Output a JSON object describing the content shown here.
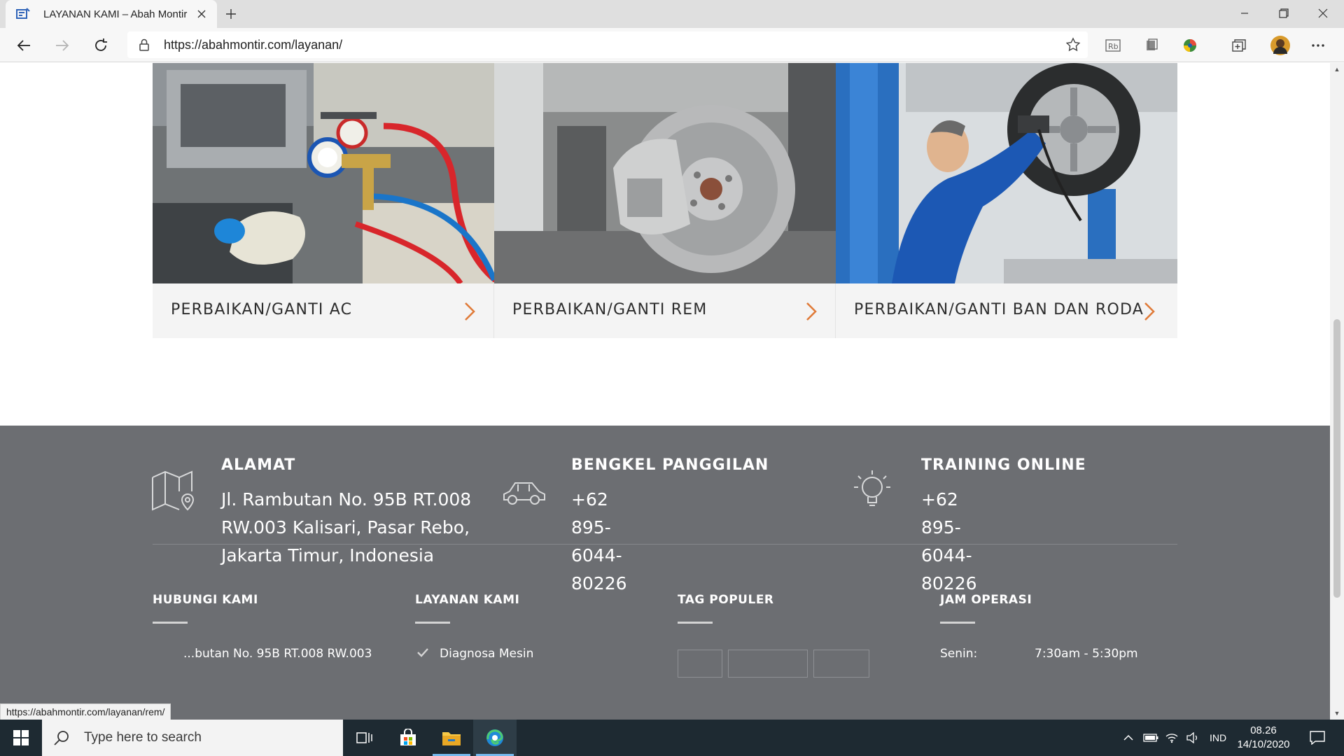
{
  "browser": {
    "tab_title": "LAYANAN KAMI – Abah Montir",
    "url": "https://abahmontir.com/layanan/",
    "status_url": "https://abahmontir.com/layanan/rem/"
  },
  "services": [
    {
      "title": "PERBAIKAN/GANTI AC"
    },
    {
      "title": "PERBAIKAN/GANTI REM"
    },
    {
      "title": "PERBAIKAN/GANTI BAN DAN RODA"
    }
  ],
  "footer": {
    "address": {
      "heading": "ALAMAT",
      "lines": [
        "Jl. Rambutan No. 95B RT.008",
        "RW.003 Kalisari, Pasar Rebo,",
        "Jakarta Timur, Indonesia"
      ]
    },
    "mobile_workshop": {
      "heading": "BENGKEL PANGGILAN",
      "phone": "+62 895-6044-80226"
    },
    "training": {
      "heading": "TRAINING ONLINE",
      "phone": "+62 895-6044-80226"
    },
    "columns": {
      "contact": {
        "heading": "HUBUNGI KAMI",
        "first_line": "...butan No. 95B RT.008 RW.003"
      },
      "services": {
        "heading": "LAYANAN KAMI",
        "first_item": "Diagnosa Mesin"
      },
      "tags": {
        "heading": "TAG POPULER"
      },
      "hours": {
        "heading": "JAM OPERASI",
        "day": "Senin:",
        "time": "7:30am - 5:30pm"
      }
    }
  },
  "taskbar": {
    "search_placeholder": "Type here to search",
    "language": "IND",
    "time": "08.26",
    "date": "14/10/2020"
  },
  "colors": {
    "accent_arrow": "#e07b39",
    "footer_bg": "#6c6e72",
    "card_bg": "#f4f4f4",
    "taskbar_bg": "#1e2a32"
  }
}
